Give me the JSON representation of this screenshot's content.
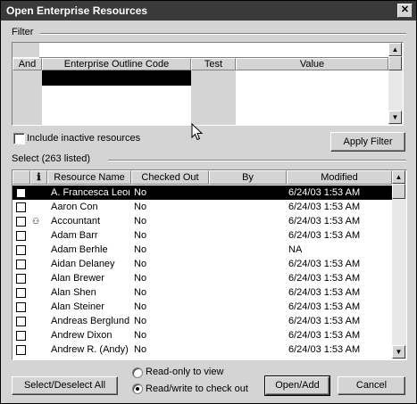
{
  "window": {
    "title": "Open Enterprise Resources",
    "close_glyph": "✕"
  },
  "filter": {
    "label": "Filter",
    "columns": [
      "And",
      "Enterprise Outline Code",
      "Test",
      "Value"
    ],
    "include_inactive_label": "Include inactive resources",
    "apply_button": "Apply Filter"
  },
  "select": {
    "label": "Select (263 listed)",
    "columns": [
      "",
      "ℹ",
      "Resource Name",
      "Checked Out",
      "By",
      "Modified"
    ],
    "rows": [
      {
        "name": "A. Francesca Leonetti",
        "checked_out": "No",
        "by": "",
        "modified": "6/24/03 1:53 AM",
        "selected": true,
        "icon": ""
      },
      {
        "name": "Aaron Con",
        "checked_out": "No",
        "by": "",
        "modified": "6/24/03 1:53 AM",
        "selected": false,
        "icon": ""
      },
      {
        "name": "Accountant",
        "checked_out": "No",
        "by": "",
        "modified": "6/24/03 1:53 AM",
        "selected": false,
        "icon": "generic-resource-icon"
      },
      {
        "name": "Adam Barr",
        "checked_out": "No",
        "by": "",
        "modified": "6/24/03 1:53 AM",
        "selected": false,
        "icon": ""
      },
      {
        "name": "Adam Berhle",
        "checked_out": "No",
        "by": "",
        "modified": "NA",
        "selected": false,
        "icon": ""
      },
      {
        "name": "Aidan Delaney",
        "checked_out": "No",
        "by": "",
        "modified": "6/24/03 1:53 AM",
        "selected": false,
        "icon": ""
      },
      {
        "name": "Alan Brewer",
        "checked_out": "No",
        "by": "",
        "modified": "6/24/03 1:53 AM",
        "selected": false,
        "icon": ""
      },
      {
        "name": "Alan Shen",
        "checked_out": "No",
        "by": "",
        "modified": "6/24/03 1:53 AM",
        "selected": false,
        "icon": ""
      },
      {
        "name": "Alan Steiner",
        "checked_out": "No",
        "by": "",
        "modified": "6/24/03 1:53 AM",
        "selected": false,
        "icon": ""
      },
      {
        "name": "Andreas Berglund",
        "checked_out": "No",
        "by": "",
        "modified": "6/24/03 1:53 AM",
        "selected": false,
        "icon": ""
      },
      {
        "name": "Andrew Dixon",
        "checked_out": "No",
        "by": "",
        "modified": "6/24/03 1:53 AM",
        "selected": false,
        "icon": ""
      },
      {
        "name": "Andrew R. (Andy)",
        "checked_out": "No",
        "by": "",
        "modified": "6/24/03 1:53 AM",
        "selected": false,
        "icon": ""
      }
    ]
  },
  "footer": {
    "select_all_button": "Select/Deselect All",
    "radio_readonly": "Read-only to view",
    "radio_readwrite": "Read/write to check out",
    "open_button": "Open/Add",
    "cancel_button": "Cancel"
  },
  "icons": {
    "scroll_up": "▲",
    "scroll_down": "▼",
    "generic_resource": "⚇"
  }
}
